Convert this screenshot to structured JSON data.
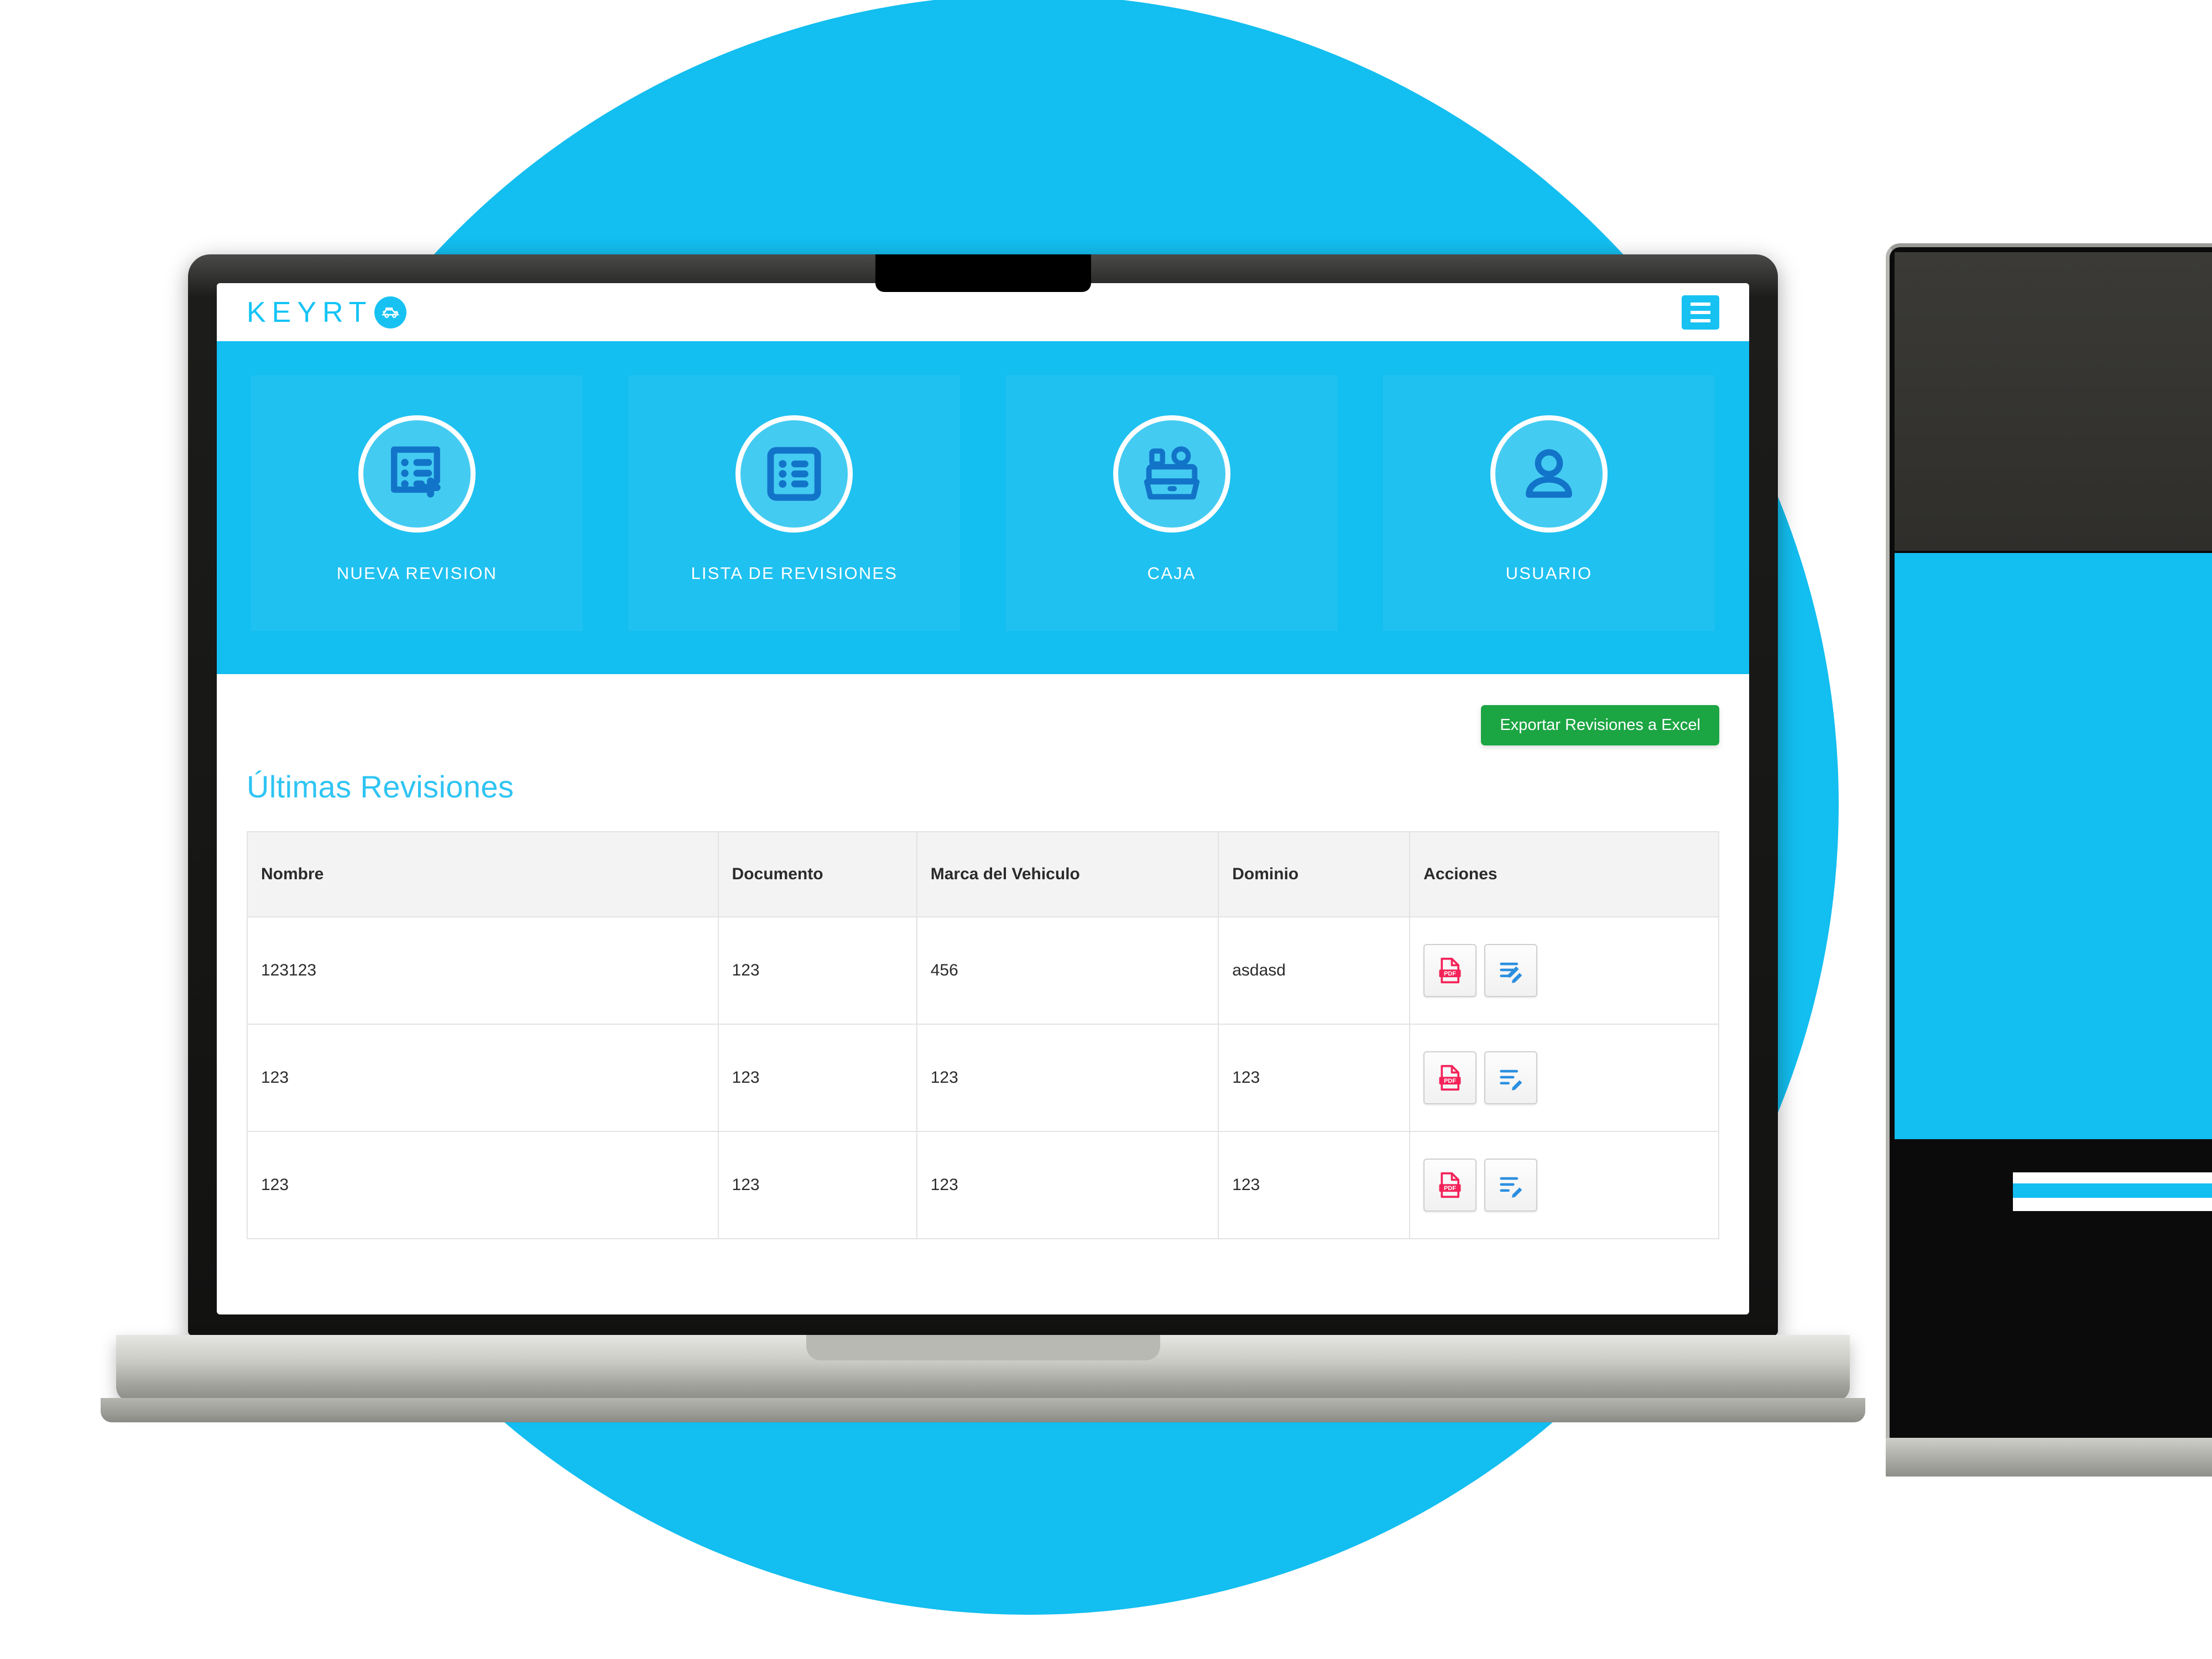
{
  "brand": {
    "logo_text": "KEYRT",
    "logo_badge_icon": "jeep-icon",
    "accent_color": "#13BEF0",
    "logo_color": "#13C4F5",
    "export_button_color": "#1CA543",
    "pdf_icon_color": "#F4235A",
    "edit_icon_color": "#2B8FE0"
  },
  "header": {
    "menu_icon": "hamburger-menu-icon"
  },
  "hero": {
    "cards": [
      {
        "label": "NUEVA REVISION",
        "icon": "new-checklist-plus-icon"
      },
      {
        "label": "LISTA DE REVISIONES",
        "icon": "list-icon"
      },
      {
        "label": "CAJA",
        "icon": "cash-register-icon"
      },
      {
        "label": "USUARIO",
        "icon": "user-icon"
      }
    ]
  },
  "content": {
    "export_label": "Exportar Revisiones a Excel",
    "section_title": "Últimas Revisiones"
  },
  "table": {
    "headers": [
      "Nombre",
      "Documento",
      "Marca del Vehiculo",
      "Dominio",
      "Acciones"
    ],
    "rows": [
      {
        "nombre": "123123",
        "documento": "123",
        "marca": "456",
        "dominio": "asdasd"
      },
      {
        "nombre": "123",
        "documento": "123",
        "marca": "123",
        "dominio": "123"
      },
      {
        "nombre": "123",
        "documento": "123",
        "marca": "123",
        "dominio": "123"
      }
    ],
    "row_actions": [
      {
        "icon": "pdf-icon",
        "name": "download-pdf-button"
      },
      {
        "icon": "edit-icon",
        "name": "edit-revision-button"
      }
    ]
  }
}
